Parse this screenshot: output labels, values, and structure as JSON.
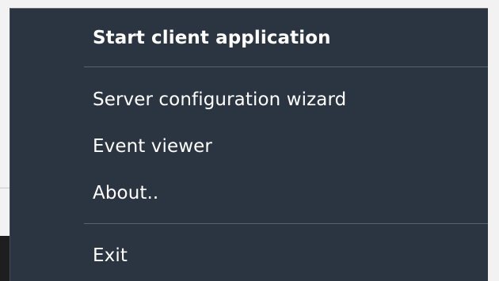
{
  "menu": {
    "items": [
      {
        "label": "Start client application",
        "default": true
      },
      {
        "label": "Server configuration wizard",
        "default": false
      },
      {
        "label": "Event viewer",
        "default": false
      },
      {
        "label": "About..",
        "default": false
      },
      {
        "label": "Exit",
        "default": false
      }
    ],
    "colors": {
      "background": "#2b3441",
      "text": "#ffffff",
      "separator": "#5b626c"
    }
  }
}
